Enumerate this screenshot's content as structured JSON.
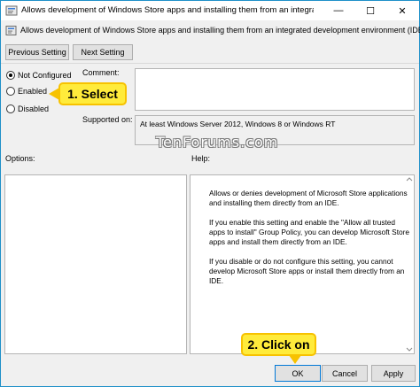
{
  "window": {
    "title": "Allows development of Windows Store apps and installing them from an integrated developme...",
    "minimize_glyph": "—",
    "maximize_glyph": "☐",
    "close_glyph": "✕"
  },
  "header": {
    "setting_name": "Allows development of Windows Store apps and installing them from an integrated development environment (IDE)"
  },
  "nav": {
    "previous_label": "Previous Setting",
    "next_label": "Next Setting"
  },
  "state": {
    "options": [
      {
        "label": "Not Configured",
        "selected": true
      },
      {
        "label": "Enabled",
        "selected": false
      },
      {
        "label": "Disabled",
        "selected": false
      }
    ]
  },
  "comment": {
    "label": "Comment:",
    "value": ""
  },
  "supported": {
    "label": "Supported on:",
    "value": "At least Windows Server 2012, Windows 8 or Windows RT"
  },
  "panels": {
    "options_label": "Options:",
    "help_label": "Help:",
    "help_paragraphs": [
      "Allows or denies development of Microsoft Store applications and installing them directly from an IDE.",
      "If you enable this setting and enable the \"Allow all trusted apps to install\" Group Policy, you can develop Microsoft Store apps and install them directly from an IDE.",
      "If you disable or do not configure this setting, you cannot develop Microsoft Store apps or install them directly from an IDE."
    ]
  },
  "footer": {
    "ok_label": "OK",
    "cancel_label": "Cancel",
    "apply_label": "Apply"
  },
  "annotations": {
    "watermark": "TenForums.com",
    "callout_select": "1. Select",
    "callout_click": "2. Click on"
  },
  "colors": {
    "accent": "#0078d7",
    "callout_fill": "#ffeb3b",
    "callout_border": "#f7c200"
  },
  "icons": {
    "title_icon": "policy-settings-icon",
    "header_icon": "policy-settings-icon"
  }
}
